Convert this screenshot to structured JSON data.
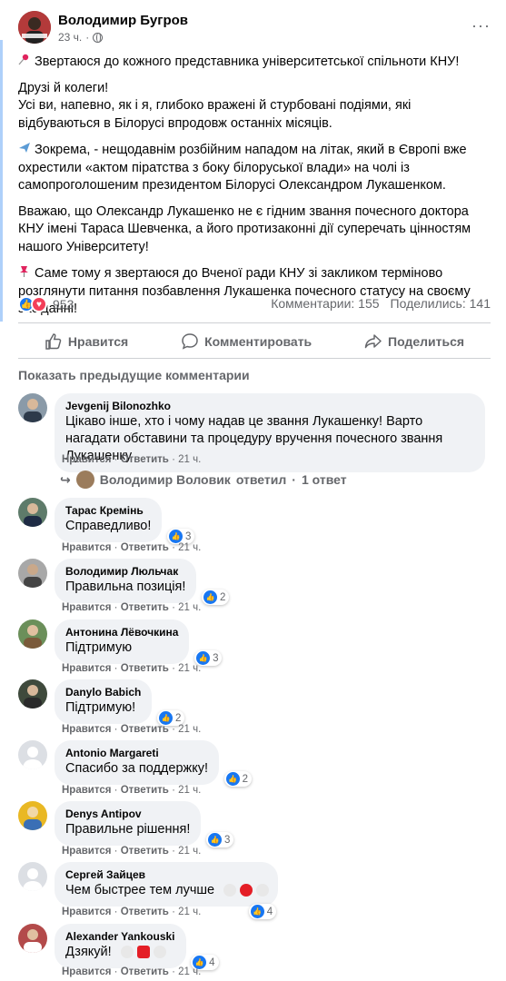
{
  "post": {
    "author": "Володимир Бугров",
    "time": "23 ч.",
    "more": "···",
    "paragraphs": [
      "Звертаюся до кожного представника університетської спільноти КНУ!",
      "Друзі й колеги!\nУсі ви, напевно, як і я, глибоко вражені й стурбовані подіями, які відбуваються в Білорусі впродовж останніх місяців.",
      "Зокрема, - нещодавнім розбійним нападом на літак, який в Європі вже охрестили «актом піратства з боку білоруської влади» на чолі із самопроголошеним президентом Білорусі Олександром Лукашенком.",
      "Вважаю, що Олександр Лукашенко не є гідним звання почесного доктора КНУ імені Тараса Шевченка, а його протизаконні дії суперечать цінностям нашого Університету!",
      "Саме тому я звертаюся до Вченої ради КНУ зі закликом терміново розглянути питання позбавлення Лукашенка почесного статусу на своєму засіданні!"
    ],
    "paragraph_icons": [
      "pin-red-icon",
      "",
      "airplane-icon",
      "",
      "pushpin-icon"
    ]
  },
  "stats": {
    "reactions_count": "953",
    "comments": "Комментарии: 155",
    "shares": "Поделились: 141"
  },
  "actions": {
    "like": "Нравится",
    "comment": "Комментировать",
    "share": "Поделиться"
  },
  "prev_comments": "Показать предыдущие комментарии",
  "comment_meta": {
    "like": "Нравится",
    "reply": "Ответить",
    "sep": "·",
    "time": "21 ч."
  },
  "comments": [
    {
      "name": "Jevgenij Bilonozhko",
      "text": "Цікаво інше, хто і чому надав це звання Лукашенку! Варто нагадати обставини та процедуру вручення почесного звання Лукашенку",
      "reacts": ""
    },
    {
      "name": "Тарас Кремінь",
      "text": "Справедливо!",
      "reacts": "3"
    },
    {
      "name": "Володимир Люльчак",
      "text": "Правильна позиція!",
      "reacts": "2"
    },
    {
      "name": "Антонина Лёвочкина",
      "text": "Підтримую",
      "reacts": "3"
    },
    {
      "name": "Danylo Babich",
      "text": "Підтримую!",
      "reacts": "2"
    },
    {
      "name": "Antonio Margareti",
      "text": "Спасибо за поддержку!",
      "reacts": "2"
    },
    {
      "name": "Denys Antipov",
      "text": "Правильне рішення!",
      "reacts": "3"
    },
    {
      "name": "Сергей Зайцев",
      "text": "Чем быстрее тем лучше",
      "reacts": "4"
    },
    {
      "name": "Alexander Yankouski",
      "text": "Дзякуй!",
      "reacts": "4"
    }
  ],
  "reply": {
    "author": "Володимир Воловик",
    "label": "ответил",
    "sep": "·",
    "count": "1 ответ"
  },
  "colors": {
    "accent": "#1877f2",
    "love": "#f33e58",
    "muted": "#65676b",
    "bubble": "#f0f2f5"
  }
}
